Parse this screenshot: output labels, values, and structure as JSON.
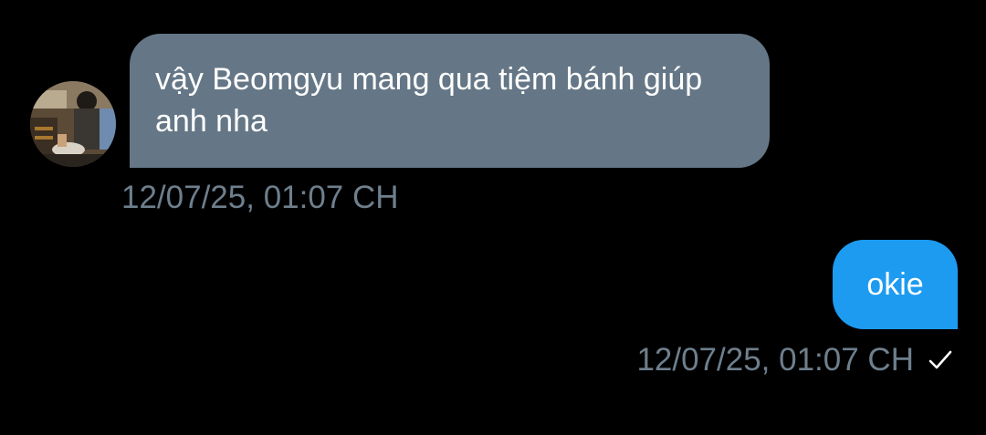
{
  "messages": [
    {
      "direction": "incoming",
      "text": "vậy Beomgyu mang qua tiệm bánh giúp anh nha",
      "timestamp": "12/07/25, 01:07 CH",
      "avatar_icon": "profile-photo",
      "bubble_color": "#657786"
    },
    {
      "direction": "outgoing",
      "text": "okie",
      "timestamp": "12/07/25, 01:07 CH",
      "status_icon": "check-icon",
      "bubble_color": "#1d9bf0"
    }
  ],
  "colors": {
    "background": "#000000",
    "timestamp": "#6e7f8d",
    "text": "#ffffff"
  }
}
